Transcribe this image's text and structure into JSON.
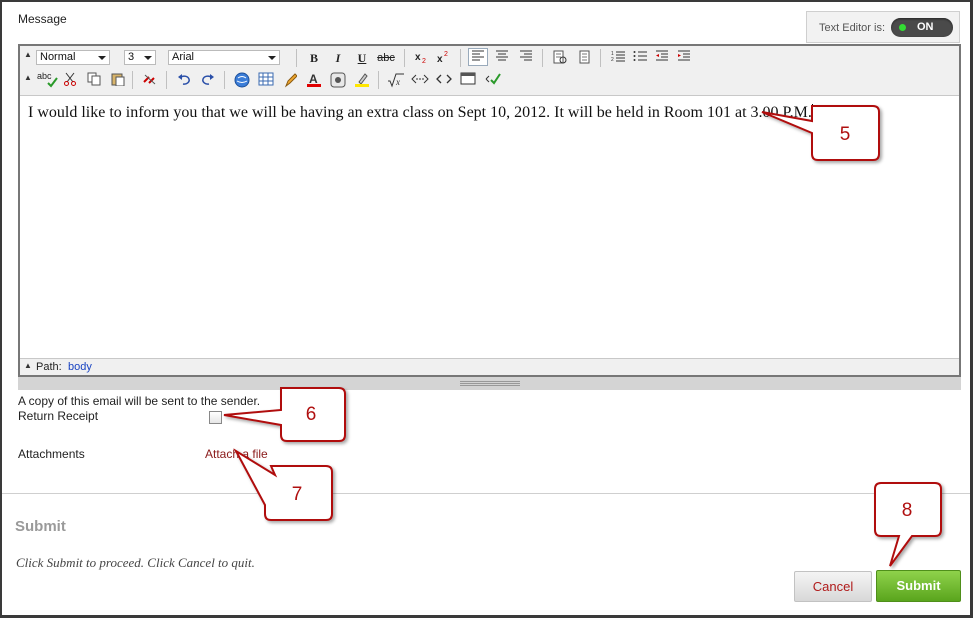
{
  "message_label": "Message",
  "text_editor": {
    "label": "Text Editor is:",
    "state": "ON"
  },
  "toolbar": {
    "paragraph_format": "Normal",
    "font_size": "3",
    "font_family": "Arial",
    "strike_label": "abc",
    "spell_label": "abc"
  },
  "editor_content": "I would like to inform you that we will be having an extra class on Sept 10, 2012. It will be held in Room 101 at 3.00 P.M.",
  "status_bar": {
    "path_label": "Path:",
    "path_value": "body"
  },
  "copy_note": "A copy of this email will be sent to the sender.",
  "return_receipt_label": "Return Receipt",
  "attachments_label": "Attachments",
  "attach_link": "Attach a file",
  "submit_section": {
    "heading": "Submit",
    "instruction": "Click Submit to proceed. Click Cancel to quit.",
    "cancel_label": "Cancel",
    "submit_label": "Submit"
  },
  "callouts": [
    "5",
    "6",
    "7",
    "8"
  ],
  "colors": {
    "callout_border": "#b01010",
    "submit_green": "#6ab62a",
    "link_red": "#8a1a1a",
    "path_blue": "#1a44c2"
  }
}
